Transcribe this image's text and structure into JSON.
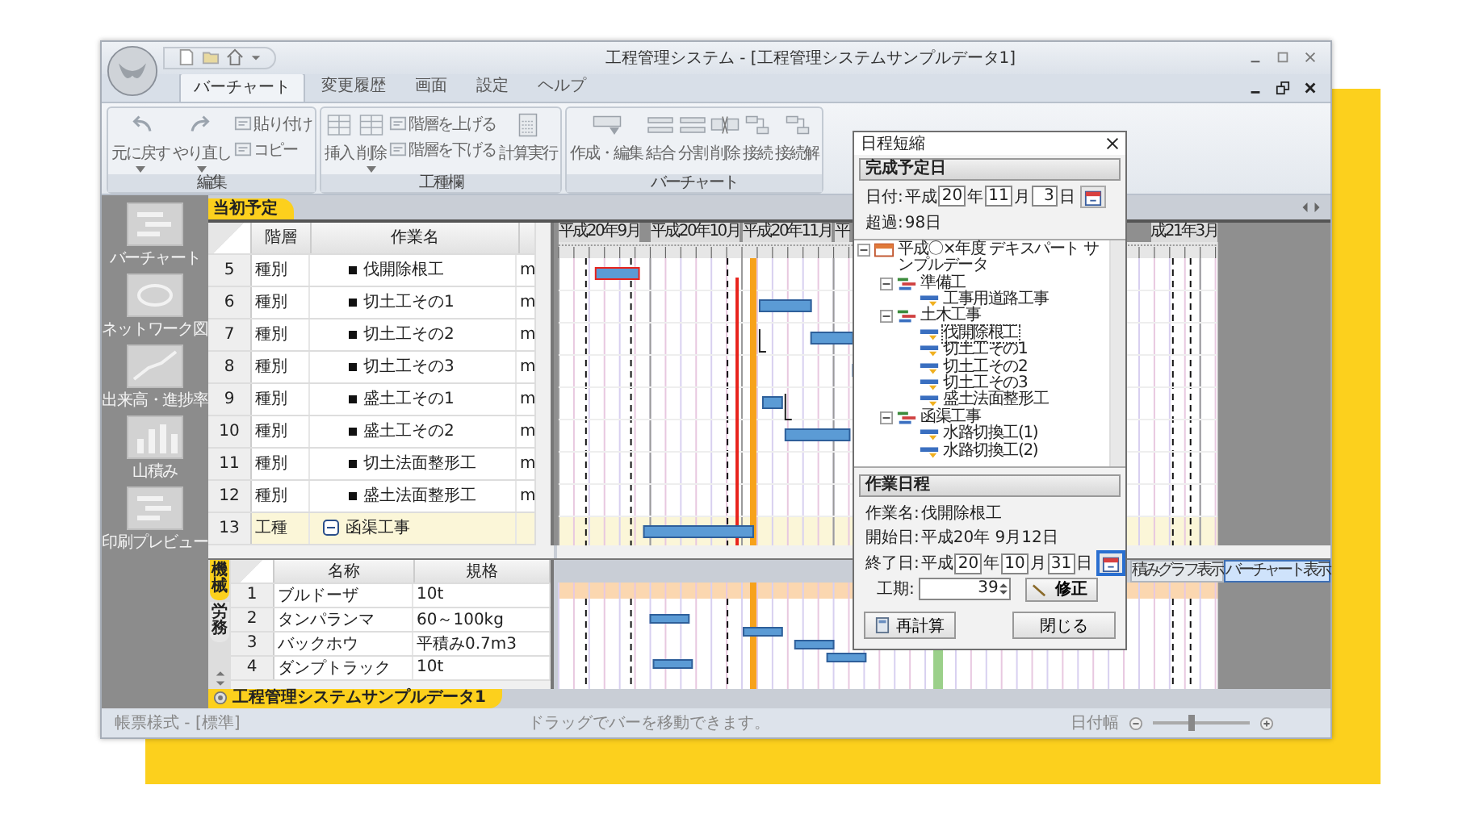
{
  "window": {
    "title": "工程管理システム - [工程管理システムサンプルデータ1]"
  },
  "menu_tabs": [
    {
      "label": "バーチャート",
      "selected": true
    },
    {
      "label": "変更履歴",
      "selected": false
    },
    {
      "label": "画面",
      "selected": false
    },
    {
      "label": "設定",
      "selected": false
    },
    {
      "label": "ヘルプ",
      "selected": false
    }
  ],
  "ribbon": {
    "groups": [
      {
        "label": "編集",
        "items": [
          {
            "kind": "large",
            "label": "元に戻す",
            "dropdown": true
          },
          {
            "kind": "large",
            "label": "やり直し",
            "dropdown": true
          },
          {
            "kind": "stack",
            "items": [
              {
                "label": "貼り付け"
              },
              {
                "label": "コピー"
              }
            ]
          }
        ]
      },
      {
        "label": "工種欄",
        "items": [
          {
            "kind": "large",
            "label": "挿入",
            "dropdown": false
          },
          {
            "kind": "large",
            "label": "削除",
            "dropdown": true
          },
          {
            "kind": "stack",
            "items": [
              {
                "label": "階層を上げる"
              },
              {
                "label": "階層を下げる"
              }
            ]
          },
          {
            "kind": "large",
            "label": "計算実行",
            "dropdown": false
          }
        ]
      },
      {
        "label": "バーチャート",
        "items": [
          {
            "kind": "large",
            "label": "作成・編集",
            "dropdown": false
          },
          {
            "kind": "large",
            "label": "結合",
            "dropdown": false
          },
          {
            "kind": "large",
            "label": "分割",
            "dropdown": false
          },
          {
            "kind": "large",
            "label": "削除",
            "dropdown": false
          },
          {
            "kind": "large",
            "label": "接続",
            "dropdown": false
          },
          {
            "kind": "large",
            "label": "接続解",
            "dropdown": false
          }
        ]
      }
    ]
  },
  "sidebar": {
    "items": [
      {
        "label": "バーチャート",
        "disabled": true
      },
      {
        "label": "ネットワーク図",
        "disabled": true
      },
      {
        "label": "出来高・進捗率",
        "disabled": true
      },
      {
        "label": "山積み",
        "disabled": true
      },
      {
        "label": "印刷プレビュー",
        "disabled": true
      }
    ]
  },
  "sheet_tab": {
    "label": "当初予定"
  },
  "grid": {
    "columns": [
      "階層",
      "作業名"
    ],
    "rows": [
      {
        "no": "5",
        "level": "種別",
        "name": "伐開除根工",
        "column_4": "m",
        "kind": "task",
        "selected": false
      },
      {
        "no": "6",
        "level": "種別",
        "name": "切土工その1",
        "column_4": "m",
        "kind": "task",
        "selected": false
      },
      {
        "no": "7",
        "level": "種別",
        "name": "切土工その2",
        "column_4": "m",
        "kind": "task",
        "selected": false
      },
      {
        "no": "8",
        "level": "種別",
        "name": "切土工その3",
        "column_4": "m",
        "kind": "task",
        "selected": false
      },
      {
        "no": "9",
        "level": "種別",
        "name": "盛土工その1",
        "column_4": "m",
        "kind": "task",
        "selected": false
      },
      {
        "no": "10",
        "level": "種別",
        "name": "盛土工その2",
        "column_4": "m",
        "kind": "task",
        "selected": false
      },
      {
        "no": "11",
        "level": "種別",
        "name": "切土法面整形工",
        "column_4": "m",
        "kind": "task",
        "selected": false
      },
      {
        "no": "12",
        "level": "種別",
        "name": "盛土法面整形工",
        "column_4": "m",
        "kind": "task",
        "selected": false
      },
      {
        "no": "13",
        "level": "工種",
        "name": "函渠工事",
        "kind": "group",
        "expanded": true,
        "selected": true
      }
    ]
  },
  "gantt": {
    "months": [
      {
        "label": "平成20年9月"
      },
      {
        "label": "平成20年10月"
      },
      {
        "label": "平成20年11月"
      },
      {
        "label": "平"
      }
    ],
    "months_right": [
      {
        "label": "成21年3月"
      }
    ]
  },
  "view_buttons": [
    {
      "label": "積みグラフ表示",
      "selected": false
    },
    {
      "label": "バーチャート表示",
      "selected": true
    }
  ],
  "resources": {
    "side_tabs": [
      {
        "label": "機械",
        "selected": true
      },
      {
        "label": "労務",
        "selected": false
      }
    ],
    "columns": [
      "名称",
      "規格"
    ],
    "rows": [
      {
        "no": "1",
        "name": "ブルドーザ",
        "spec": "10t"
      },
      {
        "no": "2",
        "name": "タンパランマ",
        "spec": "60～100kg"
      },
      {
        "no": "3",
        "name": "バックホウ",
        "spec": "平積み0.7m3"
      },
      {
        "no": "4",
        "name": "ダンプトラック",
        "spec": "10t"
      }
    ]
  },
  "document_tab": {
    "label": "工程管理システムサンプルデータ1"
  },
  "status_bar": {
    "left": "帳票様式 - [標準]",
    "center": "ドラッグでバーを移動できます。",
    "zoom_label": "日付幅",
    "zoom": {
      "level": 0.4
    }
  },
  "dialog": {
    "title": "日程短縮",
    "completion": {
      "heading": "完成予定日",
      "date_label": "日付:",
      "era": "平成",
      "year": "20",
      "year_unit": "年",
      "month": "11",
      "month_unit": "月",
      "day": "3",
      "day_unit": "日",
      "over_label": "超過:",
      "over_value": "98日"
    },
    "tree": [
      {
        "label": "平成〇×年度 デキスパート サンプルデータ",
        "kind": "project",
        "expanded": true,
        "selected": false,
        "children": [
          {
            "label": "準備工",
            "kind": "category",
            "expanded": true,
            "selected": false,
            "children": [
              {
                "label": "工事用道路工事",
                "kind": "task",
                "selected": false
              }
            ]
          },
          {
            "label": "土木工事",
            "kind": "category",
            "expanded": true,
            "selected": false,
            "children": [
              {
                "label": "伐開除根工",
                "kind": "task",
                "selected": true
              },
              {
                "label": "切土工その1",
                "kind": "task",
                "selected": false
              },
              {
                "label": "切土工その2",
                "kind": "task",
                "selected": false
              },
              {
                "label": "切土工その3",
                "kind": "task",
                "selected": false
              },
              {
                "label": "盛土法面整形工",
                "kind": "task",
                "selected": false
              }
            ]
          },
          {
            "label": "函渠工事",
            "kind": "category",
            "expanded": true,
            "selected": false,
            "children": [
              {
                "label": "水路切換工(1)",
                "kind": "task",
                "selected": false
              },
              {
                "label": "水路切換工(2)",
                "kind": "task",
                "selected": false
              }
            ]
          }
        ]
      }
    ],
    "schedule": {
      "heading": "作業日程",
      "name_label": "作業名:",
      "name": "伐開除根工",
      "start_label": "開始日:",
      "start": "平成20年 9月12日",
      "end_label": "終了日:",
      "era": "平成",
      "year": "20",
      "year_unit": "年",
      "month": "10",
      "month_unit": "月",
      "day": "31",
      "day_unit": "日",
      "duration_label": "工期:",
      "duration": "39",
      "fix_button": "修正"
    },
    "buttons": [
      {
        "label": "再計算",
        "kind": "recalc"
      },
      {
        "label": "閉じる",
        "kind": "close"
      }
    ]
  }
}
